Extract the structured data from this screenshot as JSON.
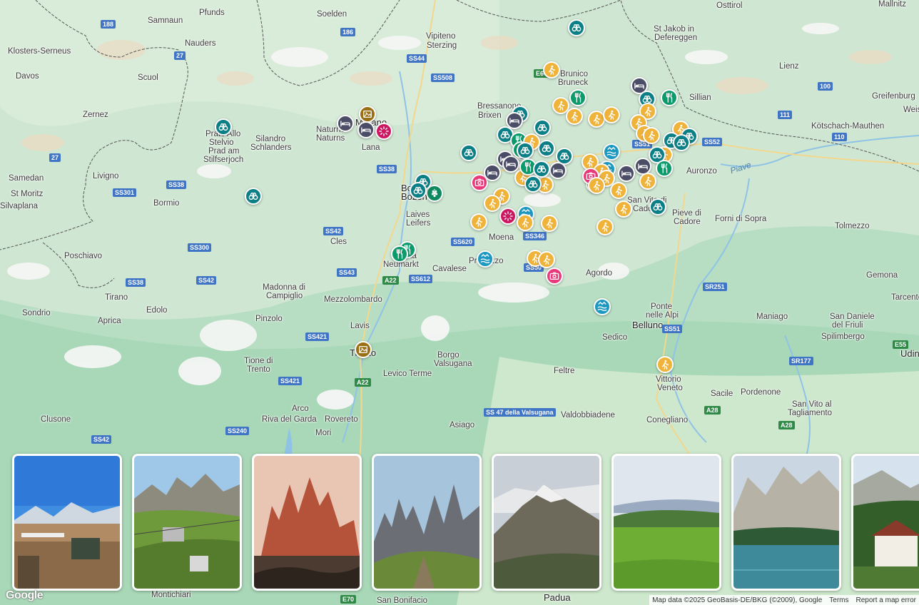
{
  "map": {
    "places": [
      {
        "id": "pfunds",
        "text": "Pfunds"
      },
      {
        "id": "soelden",
        "text": "Soelden"
      },
      {
        "id": "osttirol",
        "text": "Osttirol"
      },
      {
        "id": "mallnitz",
        "text": "Mallnitz"
      },
      {
        "id": "samnaun",
        "text": "Samnaun"
      },
      {
        "id": "nauders",
        "text": "Nauders"
      },
      {
        "id": "klosters",
        "text": "Klosters-Serneus"
      },
      {
        "id": "vipiteno",
        "text": "Vipiteno"
      },
      {
        "id": "sterzing",
        "text": "Sterzing"
      },
      {
        "id": "stjakob1",
        "text": "St Jakob in"
      },
      {
        "id": "stjakob2",
        "text": "Defereggen"
      },
      {
        "id": "davos",
        "text": "Davos"
      },
      {
        "id": "scuol",
        "text": "Scuol"
      },
      {
        "id": "brunico",
        "text": "Brunico"
      },
      {
        "id": "bruneck",
        "text": "Bruneck"
      },
      {
        "id": "lienz",
        "text": "Lienz"
      },
      {
        "id": "bressanone",
        "text": "Bressanone"
      },
      {
        "id": "brixen",
        "text": "Brixen"
      },
      {
        "id": "sillian",
        "text": "Sillian"
      },
      {
        "id": "greifenburg",
        "text": "Greifenburg"
      },
      {
        "id": "zernez",
        "text": "Zernez"
      },
      {
        "id": "weis",
        "text": "Weis"
      },
      {
        "id": "kotschach",
        "text": "Kötschach-Mauthen"
      },
      {
        "id": "prato1",
        "text": "Prato Allo"
      },
      {
        "id": "prato2",
        "text": "Stelvio"
      },
      {
        "id": "prato3",
        "text": "Prad am"
      },
      {
        "id": "prato4",
        "text": "Stilfserjoch"
      },
      {
        "id": "naturno",
        "text": "Naturno"
      },
      {
        "id": "naturns",
        "text": "Naturns"
      },
      {
        "id": "merano",
        "text": "Merano"
      },
      {
        "id": "silandro",
        "text": "Silandro"
      },
      {
        "id": "schlanders",
        "text": "Schlanders"
      },
      {
        "id": "lana",
        "text": "Lana"
      },
      {
        "id": "samedan",
        "text": "Samedan"
      },
      {
        "id": "livigno",
        "text": "Livigno"
      },
      {
        "id": "auronzo",
        "text": "Auronzo"
      },
      {
        "id": "stmoritz",
        "text": "St Moritz"
      },
      {
        "id": "silvaplana",
        "text": "Silvaplana"
      },
      {
        "id": "bormio",
        "text": "Bormio"
      },
      {
        "id": "bolzano",
        "text": "Bolzano"
      },
      {
        "id": "bozen",
        "text": "Bozen"
      },
      {
        "id": "sanvito",
        "text": "San Vito di"
      },
      {
        "id": "cadore",
        "text": "Cadore"
      },
      {
        "id": "pieve1",
        "text": "Pieve di"
      },
      {
        "id": "pieve2",
        "text": "Cadore"
      },
      {
        "id": "forni",
        "text": "Forni di Sopra"
      },
      {
        "id": "laives",
        "text": "Laives"
      },
      {
        "id": "leifers",
        "text": "Leifers"
      },
      {
        "id": "tolmezzo",
        "text": "Tolmezzo"
      },
      {
        "id": "moena",
        "text": "Moena"
      },
      {
        "id": "cles",
        "text": "Cles"
      },
      {
        "id": "poschiavo",
        "text": "Poschiavo"
      },
      {
        "id": "egna",
        "text": "Egna"
      },
      {
        "id": "neumarkt",
        "text": "Neumarkt"
      },
      {
        "id": "cavalese",
        "text": "Cavalese"
      },
      {
        "id": "predazzo",
        "text": "Predazzo"
      },
      {
        "id": "agordo",
        "text": "Agordo"
      },
      {
        "id": "gemona",
        "text": "Gemona"
      },
      {
        "id": "tirano",
        "text": "Tirano"
      },
      {
        "id": "madonna1",
        "text": "Madonna di"
      },
      {
        "id": "madonna2",
        "text": "Campiglio"
      },
      {
        "id": "mezzolombardo",
        "text": "Mezzolombardo"
      },
      {
        "id": "tarcento",
        "text": "Tarcento"
      },
      {
        "id": "sondrio",
        "text": "Sondrio"
      },
      {
        "id": "edolo",
        "text": "Edolo"
      },
      {
        "id": "aprica",
        "text": "Aprica"
      },
      {
        "id": "ponte1",
        "text": "Ponte"
      },
      {
        "id": "ponte2",
        "text": "nelle Alpi"
      },
      {
        "id": "belluno",
        "text": "Belluno"
      },
      {
        "id": "maniago",
        "text": "Maniago"
      },
      {
        "id": "sandaniele1",
        "text": "San Daniele"
      },
      {
        "id": "sandaniele2",
        "text": "del Friuli"
      },
      {
        "id": "pinzolo",
        "text": "Pinzolo"
      },
      {
        "id": "lavis",
        "text": "Lavis"
      },
      {
        "id": "sedico",
        "text": "Sedico"
      },
      {
        "id": "spilimbergo",
        "text": "Spilimbergo"
      },
      {
        "id": "udine",
        "text": "Udin"
      },
      {
        "id": "tione1",
        "text": "Tione di"
      },
      {
        "id": "tione2",
        "text": "Trento"
      },
      {
        "id": "trento",
        "text": "Trento"
      },
      {
        "id": "borgo1",
        "text": "Borgo"
      },
      {
        "id": "borgo2",
        "text": "Valsugana"
      },
      {
        "id": "levico",
        "text": "Levico Terme"
      },
      {
        "id": "feltre",
        "text": "Feltre"
      },
      {
        "id": "vittorio1",
        "text": "Vittorio"
      },
      {
        "id": "vittorio2",
        "text": "Veneto"
      },
      {
        "id": "sacile",
        "text": "Sacile"
      },
      {
        "id": "pordenone",
        "text": "Pordenone"
      },
      {
        "id": "sanvitot1",
        "text": "San Vito al"
      },
      {
        "id": "sanvitot2",
        "text": "Tagliamento"
      },
      {
        "id": "arco",
        "text": "Arco"
      },
      {
        "id": "clusone",
        "text": "Clusone"
      },
      {
        "id": "riva",
        "text": "Riva del Garda"
      },
      {
        "id": "rovereto",
        "text": "Rovereto"
      },
      {
        "id": "valdobbiadene",
        "text": "Valdobbiadene"
      },
      {
        "id": "conegliano",
        "text": "Conegliano"
      },
      {
        "id": "asiago",
        "text": "Asiago"
      },
      {
        "id": "mori",
        "text": "Mori"
      },
      {
        "id": "padua",
        "text": "Padua"
      },
      {
        "id": "sanbonifacio",
        "text": "San Bonifacio"
      },
      {
        "id": "montichiari",
        "text": "Montichiari"
      }
    ],
    "roads": [
      {
        "id": "r188",
        "text": "188"
      },
      {
        "id": "r186",
        "text": "186"
      },
      {
        "id": "r27a",
        "text": "27"
      },
      {
        "id": "rss44",
        "text": "SS44"
      },
      {
        "id": "rss508",
        "text": "SS508"
      },
      {
        "id": "r100",
        "text": "100"
      },
      {
        "id": "re66",
        "text": "E66"
      },
      {
        "id": "r111",
        "text": "111"
      },
      {
        "id": "r110",
        "text": "110"
      },
      {
        "id": "r27b",
        "text": "27"
      },
      {
        "id": "rss51a",
        "text": "SS51"
      },
      {
        "id": "rss52",
        "text": "SS52"
      },
      {
        "id": "rss38a",
        "text": "SS38"
      },
      {
        "id": "rss301",
        "text": "SS301"
      },
      {
        "id": "rss38b",
        "text": "SS38"
      },
      {
        "id": "rss42a",
        "text": "SS42"
      },
      {
        "id": "rss346",
        "text": "SS346"
      },
      {
        "id": "rss620",
        "text": "SS620"
      },
      {
        "id": "rss300",
        "text": "SS300"
      },
      {
        "id": "rss43",
        "text": "SS43"
      },
      {
        "id": "ra22a",
        "text": "A22"
      },
      {
        "id": "rss612",
        "text": "SS612"
      },
      {
        "id": "rss50",
        "text": "SS50"
      },
      {
        "id": "rss38c",
        "text": "SS38"
      },
      {
        "id": "rss42b",
        "text": "SS42"
      },
      {
        "id": "rsr251",
        "text": "SR251"
      },
      {
        "id": "rss51b",
        "text": "SS51"
      },
      {
        "id": "rss421a",
        "text": "SS421"
      },
      {
        "id": "re55",
        "text": "E55"
      },
      {
        "id": "rsr177",
        "text": "SR177"
      },
      {
        "id": "rss421b",
        "text": "SS421"
      },
      {
        "id": "ra22b",
        "text": "A22"
      },
      {
        "id": "rss47",
        "text": "SS 47 della Valsugana"
      },
      {
        "id": "ra28a",
        "text": "A28"
      },
      {
        "id": "rss240",
        "text": "SS240"
      },
      {
        "id": "ra28b",
        "text": "A28"
      },
      {
        "id": "rss42c",
        "text": "SS42"
      },
      {
        "id": "re70",
        "text": "E70"
      }
    ],
    "water": [
      {
        "id": "piave",
        "text": "Piave"
      }
    ],
    "pin_colors": {
      "hike": "#f0b33a",
      "binoculars": "#0b7f86",
      "restaurant": "#0d9a6a",
      "hotel": "#4b4d66",
      "photo": "#e8397a",
      "lake": "#1d98c0",
      "event": "#cc1862",
      "wine": "#0d8a5e",
      "museum": "#9a6e14"
    },
    "pins": [
      {
        "id": "p1",
        "type": "binoculars"
      },
      {
        "id": "p2",
        "type": "hike"
      },
      {
        "id": "p3",
        "type": "hotel"
      },
      {
        "id": "p4",
        "type": "binoculars"
      },
      {
        "id": "p5",
        "type": "restaurant"
      },
      {
        "id": "p6",
        "type": "binoculars"
      },
      {
        "id": "p7",
        "type": "restaurant"
      },
      {
        "id": "p8",
        "type": "binoculars"
      },
      {
        "id": "p9",
        "type": "hike"
      },
      {
        "id": "p10",
        "type": "hike"
      },
      {
        "id": "p11",
        "type": "hike"
      },
      {
        "id": "p12",
        "type": "hike"
      },
      {
        "id": "p13",
        "type": "hike"
      },
      {
        "id": "p14",
        "type": "hike"
      },
      {
        "id": "p15",
        "type": "hike"
      },
      {
        "id": "p16",
        "type": "hike"
      },
      {
        "id": "p17",
        "type": "hike"
      },
      {
        "id": "p18",
        "type": "hotel"
      },
      {
        "id": "p19",
        "type": "binoculars"
      },
      {
        "id": "p20",
        "type": "binoculars"
      },
      {
        "id": "p21",
        "type": "museum"
      },
      {
        "id": "p22",
        "type": "hotel"
      },
      {
        "id": "p23",
        "type": "hotel"
      },
      {
        "id": "p24",
        "type": "event"
      },
      {
        "id": "p25",
        "type": "binoculars"
      },
      {
        "id": "p26",
        "type": "lake"
      },
      {
        "id": "p27",
        "type": "binoculars"
      },
      {
        "id": "p28",
        "type": "binoculars"
      },
      {
        "id": "p29",
        "type": "binoculars"
      },
      {
        "id": "p30",
        "type": "restaurant"
      },
      {
        "id": "p31",
        "type": "hike"
      },
      {
        "id": "p32",
        "type": "hike"
      },
      {
        "id": "p33",
        "type": "binoculars"
      },
      {
        "id": "p34",
        "type": "binoculars"
      },
      {
        "id": "p35",
        "type": "binoculars"
      },
      {
        "id": "p36",
        "type": "hotel"
      },
      {
        "id": "p37",
        "type": "hotel"
      },
      {
        "id": "p38",
        "type": "restaurant"
      },
      {
        "id": "p39",
        "type": "binoculars"
      },
      {
        "id": "p40",
        "type": "hotel"
      },
      {
        "id": "p41",
        "type": "hike"
      },
      {
        "id": "p42",
        "type": "binoculars"
      },
      {
        "id": "p43",
        "type": "lake"
      },
      {
        "id": "p44",
        "type": "hike"
      },
      {
        "id": "p45",
        "type": "photo"
      },
      {
        "id": "p46",
        "type": "hike"
      },
      {
        "id": "p47",
        "type": "hike"
      },
      {
        "id": "p48",
        "type": "hike"
      },
      {
        "id": "p49",
        "type": "restaurant"
      },
      {
        "id": "p50",
        "type": "hotel"
      },
      {
        "id": "p51",
        "type": "hotel"
      },
      {
        "id": "p52",
        "type": "restaurant"
      },
      {
        "id": "p53",
        "type": "hike"
      },
      {
        "id": "p54",
        "type": "hike"
      },
      {
        "id": "p55",
        "type": "hike"
      },
      {
        "id": "p56",
        "type": "binoculars"
      },
      {
        "id": "p57",
        "type": "binoculars"
      },
      {
        "id": "p58",
        "type": "wine"
      },
      {
        "id": "p59",
        "type": "binoculars"
      },
      {
        "id": "p60",
        "type": "hike"
      },
      {
        "id": "p61",
        "type": "hike"
      },
      {
        "id": "p62",
        "type": "event"
      },
      {
        "id": "p63",
        "type": "lake"
      },
      {
        "id": "p64",
        "type": "hike"
      },
      {
        "id": "p65",
        "type": "hike"
      },
      {
        "id": "p66",
        "type": "hike"
      },
      {
        "id": "p67",
        "type": "restaurant"
      },
      {
        "id": "p68",
        "type": "lake"
      },
      {
        "id": "p69",
        "type": "hike"
      },
      {
        "id": "p70",
        "type": "hike"
      },
      {
        "id": "p71",
        "type": "photo"
      },
      {
        "id": "p72",
        "type": "lake"
      },
      {
        "id": "p73",
        "type": "museum"
      },
      {
        "id": "p74",
        "type": "hike"
      },
      {
        "id": "p75",
        "type": "binoculars"
      },
      {
        "id": "p76",
        "type": "binoculars"
      },
      {
        "id": "p77",
        "type": "binoculars"
      },
      {
        "id": "p78",
        "type": "photo"
      },
      {
        "id": "p79",
        "type": "hike"
      },
      {
        "id": "p80",
        "type": "hike"
      },
      {
        "id": "p81",
        "type": "hike"
      },
      {
        "id": "p82",
        "type": "hotel"
      },
      {
        "id": "p83",
        "type": "restaurant"
      }
    ]
  },
  "gallery": {
    "cards": [
      {
        "id": "c1",
        "scene": "terrace"
      },
      {
        "id": "c2",
        "scene": "cablecar"
      },
      {
        "id": "c3",
        "scene": "redpeaks"
      },
      {
        "id": "c4",
        "scene": "spires"
      },
      {
        "id": "c5",
        "scene": "mountain"
      },
      {
        "id": "c6",
        "scene": "meadow"
      },
      {
        "id": "c7",
        "scene": "lake"
      },
      {
        "id": "c8",
        "scene": "village"
      }
    ]
  },
  "attribution": {
    "logo": "Google",
    "map_data": "Map data ©2025 GeoBasis-DE/BKG (©2009), Google",
    "terms": "Terms",
    "report": "Report a map error"
  }
}
